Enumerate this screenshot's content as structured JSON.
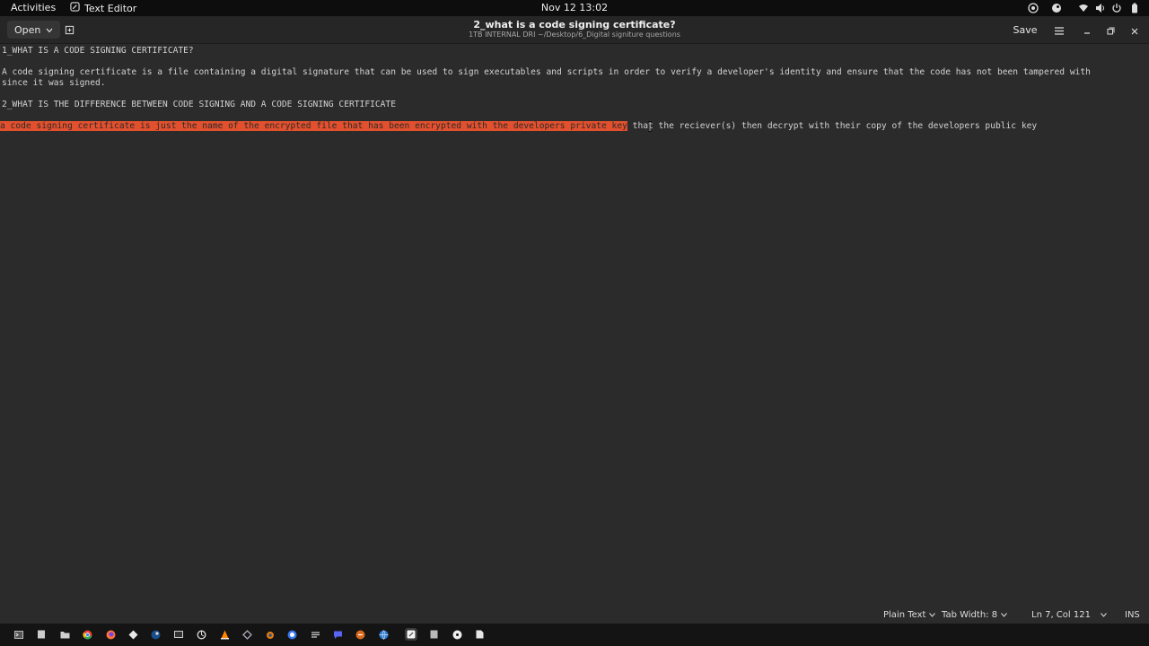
{
  "topbar": {
    "activities": "Activities",
    "app_name": "Text Editor",
    "clock": "Nov 12  13:02"
  },
  "header": {
    "open_label": "Open",
    "title": "2_what is a code signing certificate?",
    "path": "1TB INTERNAL DRI ~/Desktop/6_Digital signiture questions",
    "save_label": "Save"
  },
  "editor": {
    "lines": [
      "1_WHAT IS A CODE SIGNING CERTIFICATE?",
      "A code signing certificate is a file containing a digital signature that can be used to sign executables and scripts in order to verify a developer's identity and ensure that the code has not been tampered with",
      "since it was signed.",
      "2_WHAT IS THE DIFFERENCE BETWEEN CODE SIGNING AND A CODE SIGNING CERTIFICATE"
    ],
    "line7_selected": "a code signing certificate is just the name of the encrypted file that has been encrypted with the developers private key",
    "line7_rest": " that the reciever(s) then decrypt with their copy of the developers public key"
  },
  "statusbar": {
    "language": "Plain Text",
    "tab_width": "Tab Width: 8",
    "position": "Ln 7, Col 121",
    "mode": "INS"
  },
  "dock": {
    "items": [
      "terminal-icon",
      "files-icon",
      "folder-icon",
      "chrome-icon",
      "firefox-icon",
      "app-icon",
      "steam-icon",
      "terminal-alt-icon",
      "sync-icon",
      "vlc-icon",
      "tool-icon",
      "blender-icon",
      "signal-icon",
      "editor-icon",
      "chat-icon",
      "app2-icon",
      "globe-icon",
      "text-editor-icon",
      "document-icon",
      "disc-icon",
      "file-icon"
    ]
  }
}
